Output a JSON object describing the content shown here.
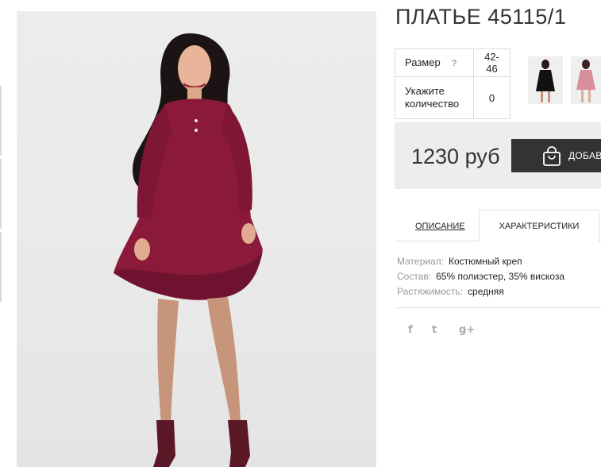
{
  "product": {
    "title": "ПЛАТЬЕ 45115/1"
  },
  "options": {
    "size_label": "Размер",
    "size_help": "?",
    "size_value": "42-46",
    "quantity_label_line1": "Укажите",
    "quantity_label_line2": "количество",
    "quantity_value": "0"
  },
  "purchase": {
    "price": "1230 руб",
    "add_button_label": "ДОБАВ"
  },
  "tabs": [
    {
      "label": "ОПИСАНИЕ",
      "active": false
    },
    {
      "label": "ХАРАКТЕРИСТИКИ",
      "active": true
    }
  ],
  "characteristics": [
    {
      "key": "Материал:",
      "value": "Костюмный креп"
    },
    {
      "key": "Состав:",
      "value": "65% полиэстер, 35% вискоза"
    },
    {
      "key": "Растяжимость:",
      "value": "средняя"
    }
  ],
  "social": {
    "facebook": "f",
    "twitter": "t",
    "googleplus": "g+"
  },
  "colors": {
    "dress": "#8b1a3a",
    "button": "#333333",
    "price_bg": "#ededed"
  }
}
